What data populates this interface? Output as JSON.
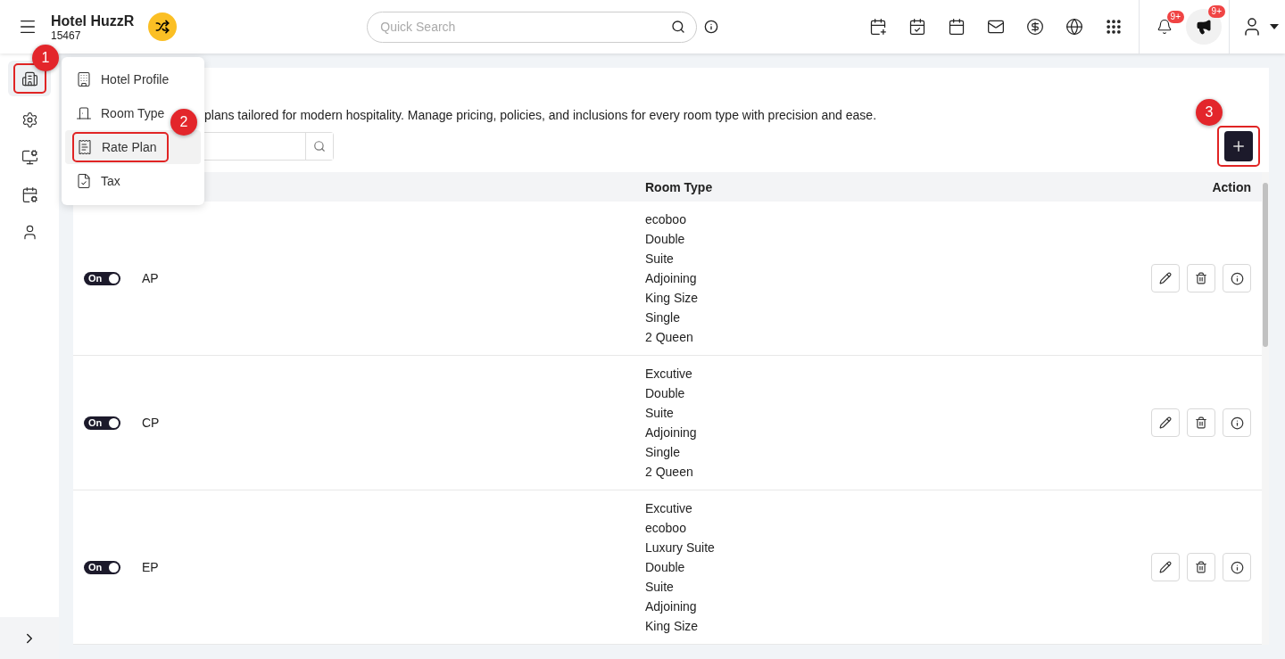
{
  "header": {
    "title": "Hotel HuzzR",
    "code": "15467",
    "search": {
      "placeholder": "Quick Search"
    },
    "notification_badge": "9+",
    "announcement_badge": "9+"
  },
  "sidebar": {
    "items": [
      {
        "kind": "hotel",
        "selected": true,
        "marker": "1"
      },
      {
        "kind": "settings",
        "selected": false
      },
      {
        "kind": "display",
        "selected": false
      },
      {
        "kind": "calendar",
        "selected": false
      },
      {
        "kind": "user",
        "selected": false
      }
    ]
  },
  "menu": {
    "items": [
      {
        "kind": "profile",
        "label": "Hotel Profile",
        "selected": false
      },
      {
        "kind": "room",
        "label": "Room Type",
        "selected": false
      },
      {
        "kind": "rate",
        "label": "Rate Plan",
        "selected": true,
        "marker": "2"
      },
      {
        "kind": "tax",
        "label": "Tax",
        "selected": false
      }
    ]
  },
  "page": {
    "description": "plans tailored for modern hospitality. Manage pricing, policies, and inclusions for every room type with precision and ease.",
    "add_button_marker": "3"
  },
  "table": {
    "columns": [
      "Room Type",
      "Action"
    ],
    "rows": [
      {
        "on": true,
        "toggle_label": "On",
        "rate_plan": "AP",
        "room_types": [
          "ecoboo",
          "Double",
          "Suite",
          "Adjoining",
          "King Size",
          "Single",
          "2 Queen"
        ]
      },
      {
        "on": true,
        "toggle_label": "On",
        "rate_plan": "CP",
        "room_types": [
          "Excutive",
          "Double",
          "Suite",
          "Adjoining",
          "Single",
          "2 Queen"
        ]
      },
      {
        "on": true,
        "toggle_label": "On",
        "rate_plan": "EP",
        "room_types": [
          "Excutive",
          "ecoboo",
          "Luxury Suite",
          "Double",
          "Suite",
          "Adjoining",
          "King Size"
        ]
      }
    ]
  }
}
